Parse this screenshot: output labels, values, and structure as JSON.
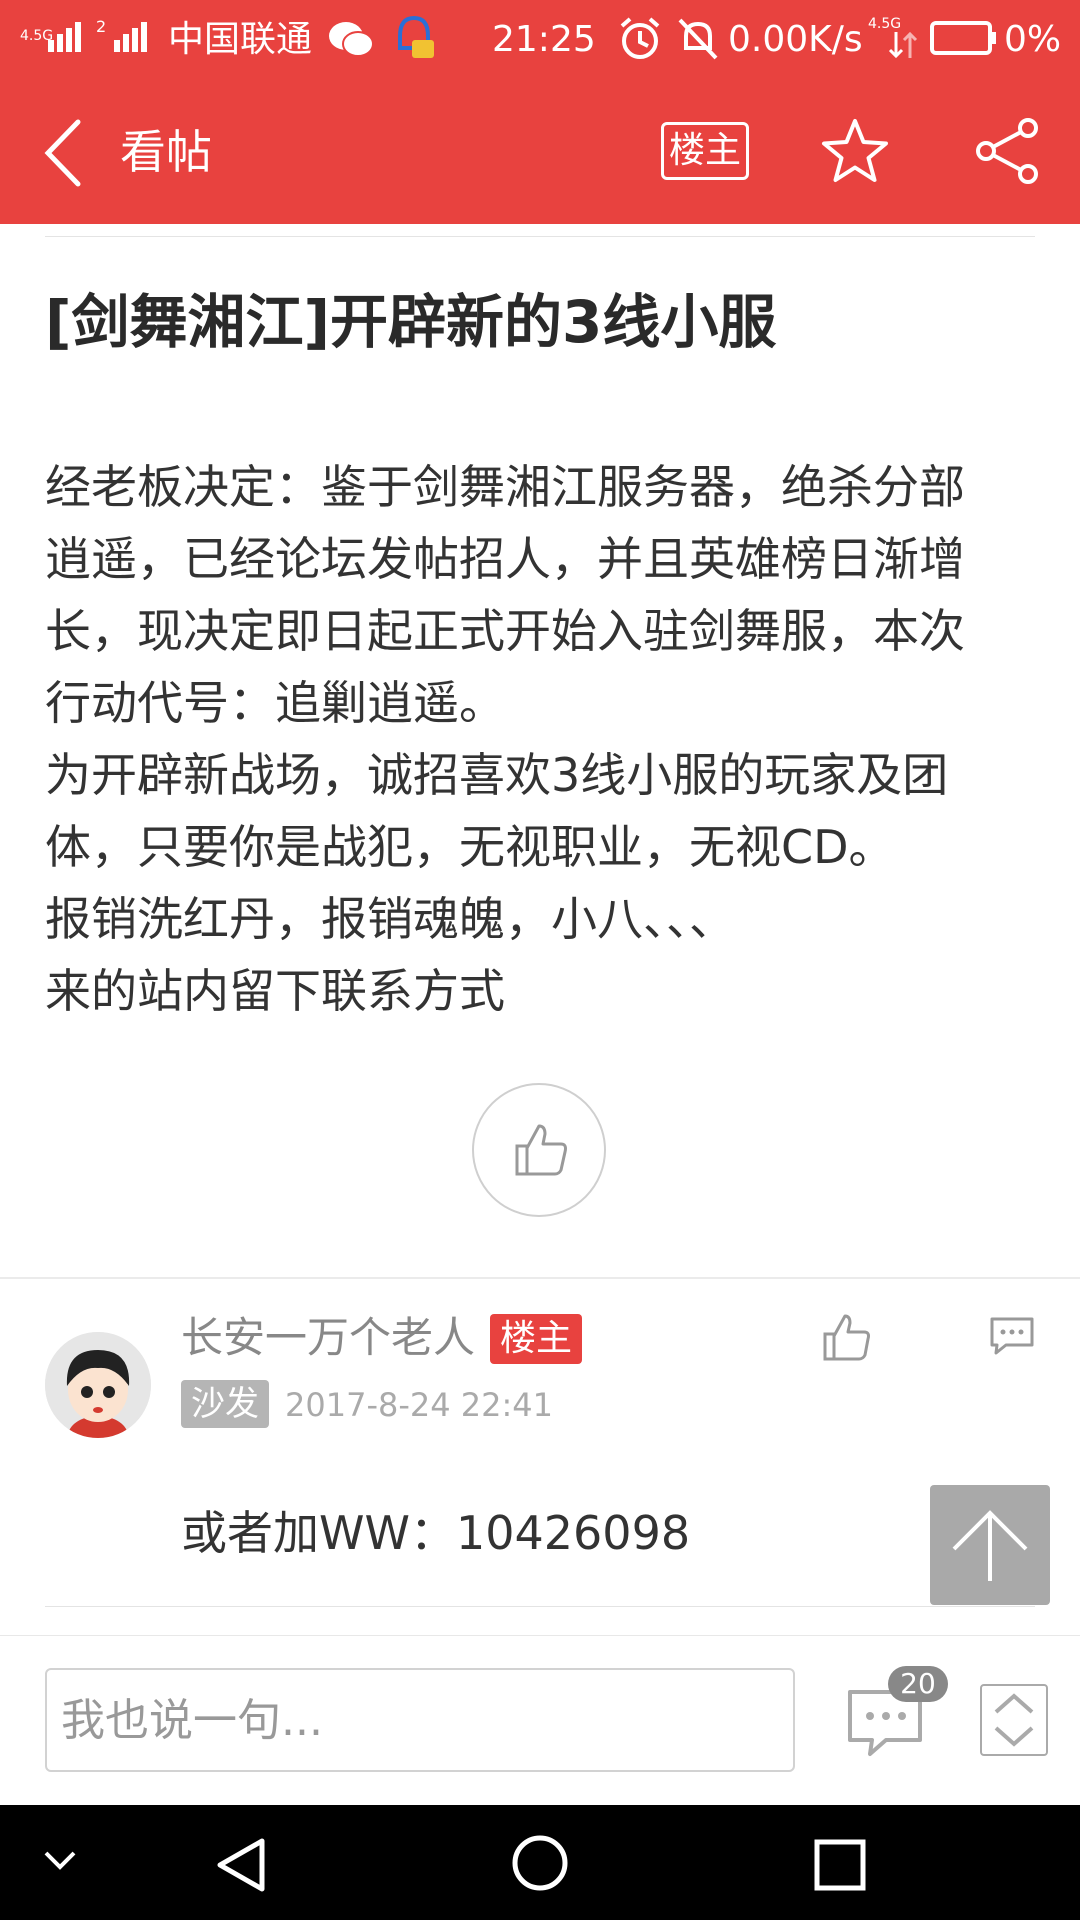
{
  "status_bar": {
    "carrier": "中国联通",
    "network_1": "4.5G",
    "network_2": "2",
    "time": "21:25",
    "speed": "0.00K/s",
    "network_3": "4.5G",
    "battery": "0%"
  },
  "header": {
    "title": "看帖",
    "op_label": "楼主"
  },
  "post": {
    "title": "[剑舞湘江]开辟新的3线小服",
    "body_lines": [
      "经老板决定：鉴于剑舞湘江服务器，绝杀分部",
      "逍遥，已经论坛发帖招人，并且英雄榜日渐增",
      "长，现决定即日起正式开始入驻剑舞服，本次",
      "行动代号：追剿逍遥。",
      "为开辟新战场，诚招喜欢3线小服的玩家及团",
      "体，只要你是战犯，无视职业，无视CD。",
      "报销洗红丹，报销魂魄，小八、、、",
      "来的站内留下联系方式"
    ]
  },
  "reply": {
    "author": "长安一万个老人",
    "op_badge": "楼主",
    "floor": "沙发",
    "time": "2017-8-24 22:41",
    "content": "或者加WW：10426098"
  },
  "bottom_bar": {
    "input_placeholder": "我也说一句...",
    "comment_count": "20"
  },
  "colors": {
    "brand_red": "#e8423f"
  },
  "icons": [
    "back-icon",
    "star-icon",
    "share-icon",
    "thumbs-up-icon",
    "comment-icon",
    "arrow-up-icon",
    "chevron-updown-icon"
  ]
}
